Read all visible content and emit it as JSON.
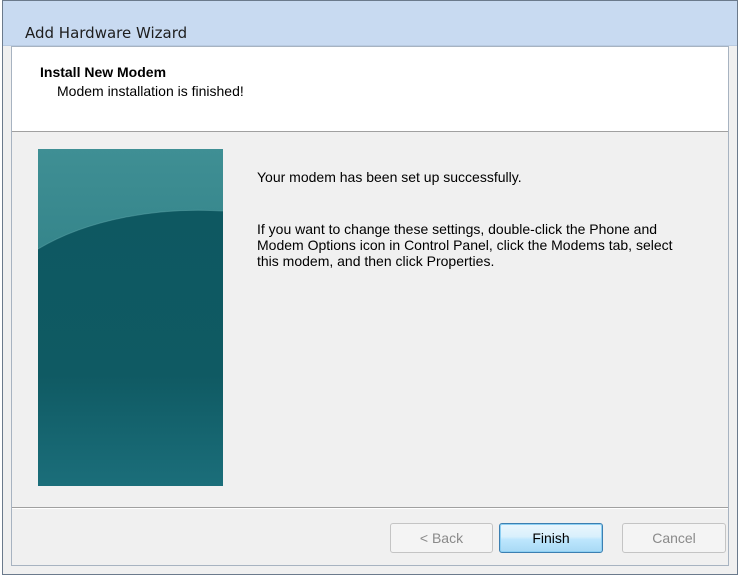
{
  "window": {
    "title": "Add Hardware Wizard"
  },
  "header": {
    "title": "Install New Modem",
    "subtitle": "Modem installation is finished!"
  },
  "content": {
    "line1": "Your modem has been set up successfully.",
    "line2": "If you want to change these settings, double-click the Phone and Modem Options icon in Control Panel, click the Modems tab, select this modem, and then click Properties."
  },
  "buttons": {
    "back_label": "< Back",
    "finish_label": "Finish",
    "cancel_label": "Cancel"
  },
  "colors": {
    "banner_teal": "#145e66",
    "titlebar": "#c8daf1",
    "default_button_border": "#3c7fb1"
  }
}
